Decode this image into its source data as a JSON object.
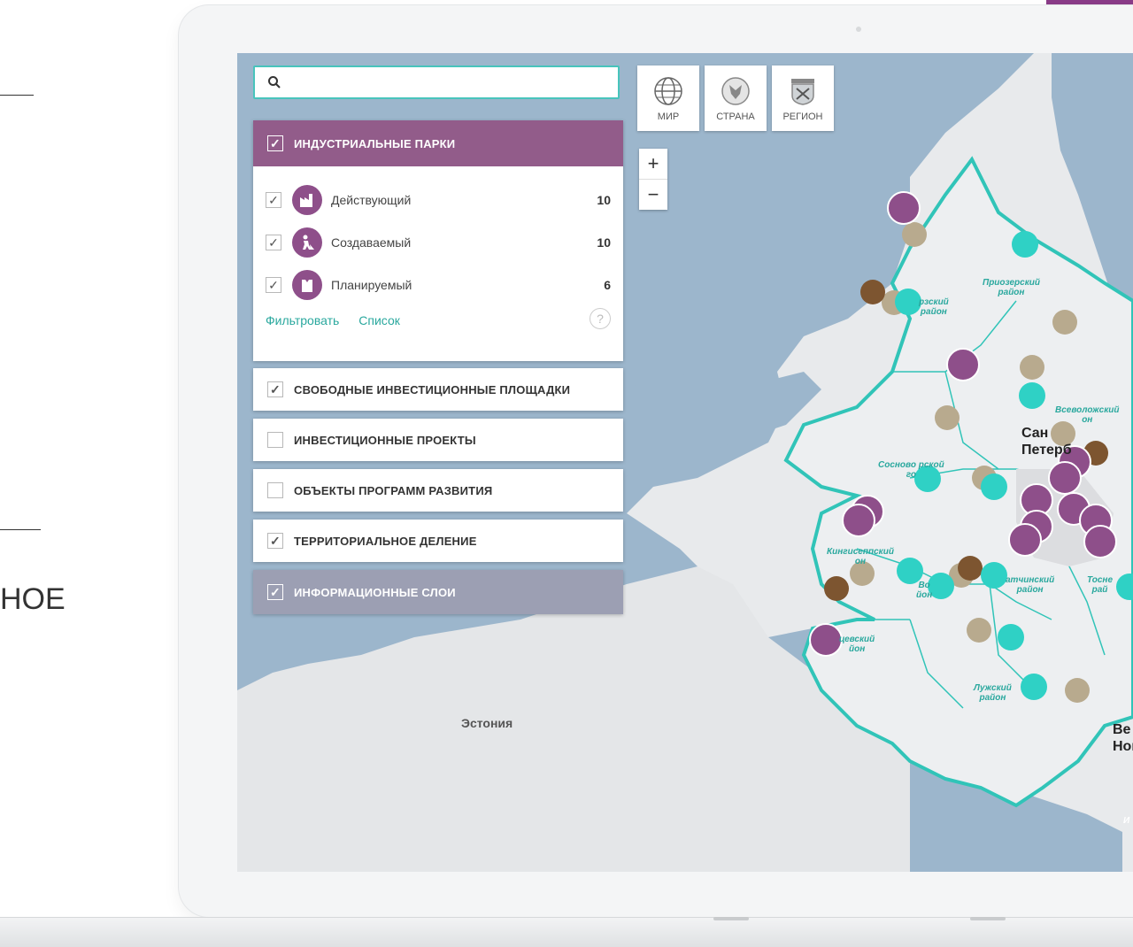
{
  "side": {
    "partial_text": "НОЕ"
  },
  "search": {
    "placeholder": ""
  },
  "layers": {
    "industrial_parks": {
      "label": "ИНДУСТРИАЛЬНЫЕ ПАРКИ",
      "items": [
        {
          "label": "Действующий",
          "count": "10",
          "icon": "factory-icon"
        },
        {
          "label": "Создаваемый",
          "count": "10",
          "icon": "construction-worker-icon"
        },
        {
          "label": "Планируемый",
          "count": "6",
          "icon": "planned-building-icon"
        }
      ],
      "filter_label": "Фильтровать",
      "list_label": "Список",
      "help_label": "?"
    },
    "free_sites": {
      "label": "СВОБОДНЫЕ ИНВЕСТИЦИОННЫЕ ПЛОЩАДКИ"
    },
    "projects": {
      "label": "ИНВЕСТИЦИОННЫЕ ПРОЕКТЫ"
    },
    "programs": {
      "label": "ОБЪЕКТЫ ПРОГРАММ РАЗВИТИЯ"
    },
    "territory": {
      "label": "ТЕРРИТОРИАЛЬНОЕ ДЕЛЕНИЕ"
    },
    "info": {
      "label": "ИНФОРМАЦИОННЫЕ СЛОИ"
    }
  },
  "scope_buttons": [
    {
      "label": "МИР",
      "icon": "globe-icon"
    },
    {
      "label": "СТРАНА",
      "icon": "country-emblem-icon"
    },
    {
      "label": "РЕГИОН",
      "icon": "region-coat-of-arms-icon"
    }
  ],
  "zoom": {
    "in": "+",
    "out": "−"
  },
  "map_labels": {
    "estonia": "Эстония",
    "spb_line1": "Сан",
    "spb_line2": "Петерб",
    "vel_line1": "Ве",
    "vel_line2": "Нов",
    "priozersky_line1": "Приозерский",
    "priozersky_line2": "район",
    "vyborgsky_line1": "рзский",
    "vyborgsky_line2": "район",
    "vsevolozhsky_line1": "Всеволожский",
    "vsevolozhsky_line2": "он",
    "sosnovoborsky_line1": "Сосново",
    "sosnovoborsky_line2": "рской",
    "sosnovoborsky_line3": "го",
    "kingiseppsky_line1": "Кингисеппский",
    "kingiseppsky_line2": "он",
    "volosovsky_line1": "Во",
    "volosovsky_line2": "йон",
    "gatchinsky_line1": "атчинский",
    "gatchinsky_line2": "район",
    "tosnensky_line1": "Тосне",
    "tosnensky_line2": "рай",
    "slantsevsky_line1": "цевский",
    "slantsevsky_line2": "йон",
    "luzhsky_line1": "Лужский",
    "luzhsky_line2": "район",
    "lake_partial": "И"
  },
  "colors": {
    "accent_purple": "#925c8a",
    "teal": "#2fd1c5",
    "tan_marker": "#b8aa8e",
    "brown_marker": "#7d5530",
    "info_gray": "#9c9fb3"
  }
}
